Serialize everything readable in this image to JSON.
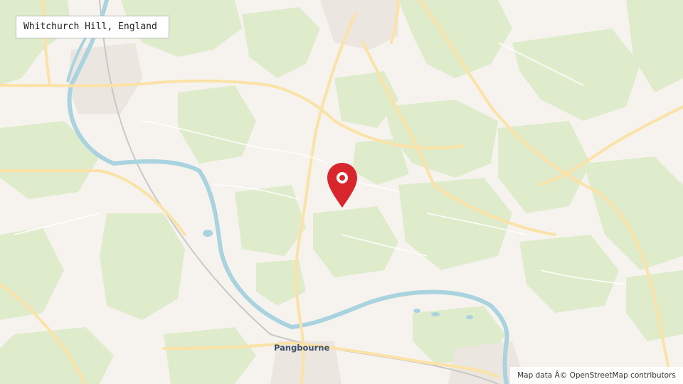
{
  "location": {
    "title": "Whitchurch Hill, England"
  },
  "map": {
    "place_labels": {
      "town": "Pangbourne"
    },
    "marker_icon": "location-pin-icon",
    "marker_color": "#d9262d",
    "colors": {
      "background": "#f6f3ee",
      "woodland": "#dfeccc",
      "river": "#a9d3df",
      "road": "#fbe2a6",
      "railway": "#c8c8c8"
    }
  },
  "attribution": {
    "text": "Map data Â© OpenStreetMap contributors"
  }
}
